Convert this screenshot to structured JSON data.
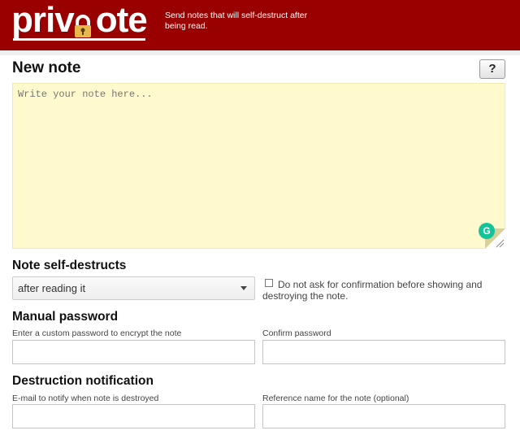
{
  "header": {
    "logo_text_left": "priv",
    "logo_text_right": "ote",
    "tagline": "Send notes that will self-destruct after being read.",
    "brand_color": "#990000"
  },
  "note": {
    "title": "New note",
    "help_label": "?",
    "placeholder": "Write your note here...",
    "grammarly_label": "G"
  },
  "self_destruct": {
    "title": "Note self-destructs",
    "selected_option": "after reading it",
    "confirm_label": "Do not ask for confirmation before showing and destroying the note."
  },
  "manual_password": {
    "title": "Manual password",
    "password_label": "Enter a custom password to encrypt the note",
    "confirm_label": "Confirm password"
  },
  "destruction_notification": {
    "title": "Destruction notification",
    "email_label": "E-mail to notify when note is destroyed",
    "reference_label": "Reference name for the note (optional)"
  }
}
